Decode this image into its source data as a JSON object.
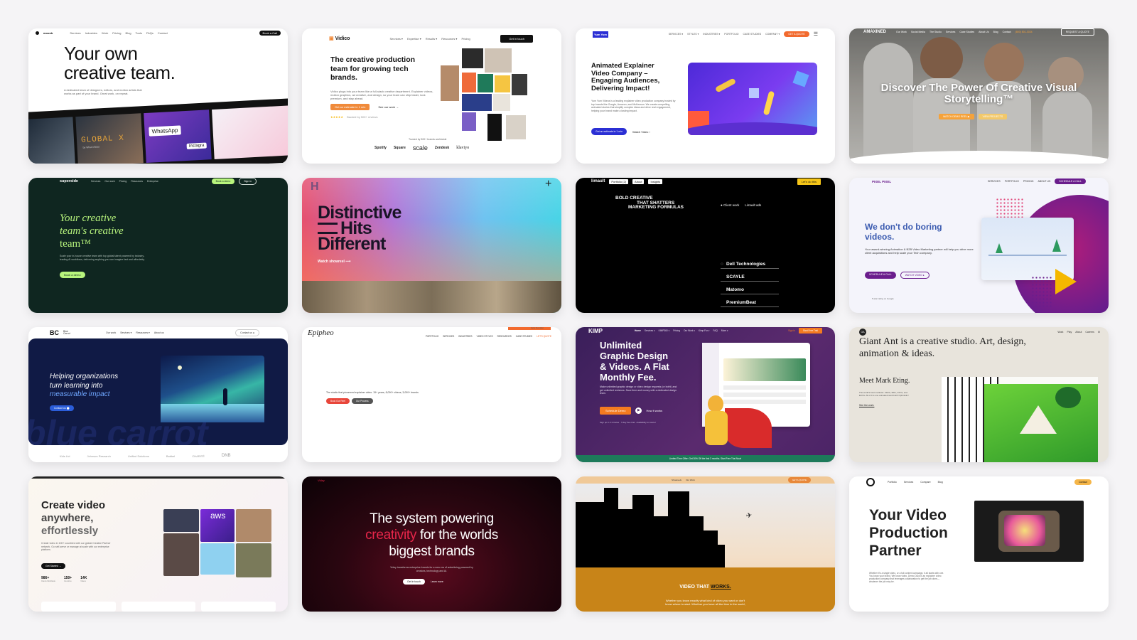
{
  "cards": {
    "c1": {
      "logo": "moonb",
      "nav": [
        "Services",
        "Industries",
        "Work",
        "Pricing",
        "Blog",
        "Tools",
        "FAQs",
        "Contact"
      ],
      "cta": "Book a Call",
      "headline_1": "Your own",
      "headline_2": "creative team.",
      "sub": "A dedicated team of designers, editors, and motion artists that works as part of your brand. Great work, on repeat.",
      "film_1": "GLOBAL X",
      "film_1_sub": "by Wired Asiaa",
      "film_2": "WhatsApp",
      "film_3": "Instagra"
    },
    "c2": {
      "logo": "Vidico",
      "nav": [
        "Services ▾",
        "Expertise ▾",
        "Results ▾",
        "Resources ▾",
        "Pricing"
      ],
      "cta": "Get in touch",
      "headline": "The creative production team for growing tech brands.",
      "sub": "Vidico plugs into your team like a full-stack creative department. Explainer videos, motion graphics, ad creative, and design, so your team can ship faster, look premium, and stay ahead.",
      "btn_primary": "Get an estimate in 1 min",
      "btn_secondary": "See our work →",
      "rating": "★★★★★",
      "rating_text": "Backed by 500+ reviews",
      "trusted": "Trusted by 500+ brands worldwide",
      "logos": [
        "Spotify",
        "Square",
        "scale",
        "Zendesk",
        "klaviyo"
      ]
    },
    "c3": {
      "logo": "Yum Yum",
      "nav": [
        "SERVICES ▾",
        "STYLES ▾",
        "INDUSTRIES ▾",
        "PORTFOLIO",
        "CASE STUDIES",
        "COMPANY ▾"
      ],
      "cta": "GET A QUOTE",
      "headline": "Animated Explainer Video Company – Engaging Audiences, Delivering Impact!",
      "sub": "Yum Yum Videos is a leading explainer video production company trusted by top brands like Google, Amazon, and McKesson. We create compelling, animated stories that simplify complex ideas and drive real engagement, helping your brand make a lasting impact.",
      "btn_primary": "Get an estimate in 1 min",
      "btn_secondary": "Watch Video ›"
    },
    "c4": {
      "logo": "AMAXINED",
      "nav": [
        "Our Work",
        "Social Media",
        "The Studio",
        "Services",
        "Case Studies",
        "About Us",
        "Blog",
        "Contact"
      ],
      "phone": "(800) 801-3024",
      "cta": "REQUEST A QUOTE",
      "headline_1": "Discover The Power Of Creative Visual",
      "headline_2": "Storytelling™",
      "btn_primary": "WATCH DEMO REEL ▶",
      "btn_secondary": "VIEW PROJECTS"
    },
    "c5": {
      "logo": "superside",
      "nav": [
        "Services",
        "Our work",
        "Pricing",
        "Resources",
        "Enterprise"
      ],
      "cta": "Book a demo",
      "signin": "Sign in",
      "headline_1": "Your creative",
      "headline_2": "team's creative",
      "headline_3": "team™",
      "sub": "Scale your in-house creative team with top global talent powered by industry-leading AI workflows, delivering anything you can imagine fast and affordably.",
      "btn": "Book a demo"
    },
    "c6": {
      "logo": "H",
      "plus": "+",
      "headline_1": "Distinctive",
      "headline_2": "Hits",
      "headline_3": "Different",
      "link": "Watch showreel ⟶"
    },
    "c7": {
      "logo": "limault",
      "tabs": [
        "Portfolio (2)",
        "About",
        "Insights"
      ],
      "cta": "Let's do this",
      "headline_1": "BOLD CREATIVE",
      "headline_2": "THAT SHATTERS",
      "headline_3": "MARKETING FORMULAS",
      "filter_1": "Client work",
      "filter_2": "Limault ads",
      "clients": [
        "Dell Technologies",
        "SCAYLE",
        "Matomo",
        "PremiumBeat"
      ]
    },
    "c8": {
      "logo": "PIXEL PIXEL",
      "nav": [
        "SERVICES",
        "PORTFOLIO",
        "PRICING",
        "ABOUT US"
      ],
      "cta": "SCHEDULE A CALL",
      "headline": "We don't do boring videos.",
      "sub": "Your award-winning Animation & B2B Video Marketing partner will help you drive more client acquisitions and help scale your Tech company.",
      "btn_primary": "SCHEDULE A CALL",
      "btn_secondary": "WATCH VIDEO ▸",
      "rating": "5-star rating on Google"
    },
    "c9": {
      "logo": "BC",
      "logo_text": "Blue Carrot",
      "nav": [
        "Our work",
        "Services ▾",
        "Resources ▾",
        "About us"
      ],
      "cta": "Contact us",
      "headline_1": "Helping organizations",
      "headline_2": "turn learning into",
      "headline_3": "measurable impact",
      "btn": "Contact us",
      "bg_text": "blue carrot",
      "logos": [
        "Kids Ltd",
        "Johnson Research",
        "Unified Solutions",
        "Babbel",
        "CHARITÉ",
        "DNB"
      ]
    },
    "c10": {
      "logo": "Epipheo",
      "nav": [
        "PORTFOLIO",
        "SERVICES",
        "INDUSTRIES",
        "VIDEO STYLES",
        "RESOURCES",
        "CASE STUDIES",
        "LET'S QUOTE"
      ],
      "promo": "Get a free video",
      "sub": "The studio that pioneered explainer video. 15+ years, 8,000+ videos, 3,000+ brands",
      "btn_primary": "Book Our Reel",
      "btn_secondary": "Our Process"
    },
    "c11": {
      "logo": "KIMP",
      "nav": [
        "Home",
        "Services ▾",
        "KIMP360 ▾",
        "Pricing",
        "Our Work ▾",
        "Kimp For ▾",
        "FAQ",
        "More ▾"
      ],
      "signin": "Sign in",
      "cta": "Start Free Trial",
      "headline_1": "Unlimited",
      "headline_2": "Graphic Design",
      "headline_3": "& Videos. A Flat",
      "headline_4": "Monthly Fee.",
      "sub": "Make unlimited graphic design or video design requests (or both!) and get unlimited revisions. Save time and money with a dedicated design team.",
      "btn_primary": "Schedule Demo",
      "btn_secondary": "How it works",
      "note": "Sign up in 2 minutes · 7-day free trial · Availability to cancel",
      "banner": "Limited Time Offer: Get 30% Off the first 3 months. Start Free Trial Now!"
    },
    "c12": {
      "logo": "GA",
      "nav": [
        "Work",
        "Play",
        "About",
        "Careers"
      ],
      "headline": "Giant Ant is a creative studio. Art, design, animation & ideas.",
      "subhead": "Meet Mark Eting.",
      "sub": "The world's best marketer. CEOs, MDs, CFOs, and ECOs. All of it is one animated world with Optimistic!",
      "link": "See the work."
    },
    "c13": {
      "headline_1": "Create video",
      "headline_2": "anywhere,",
      "headline_3": "effortlessly",
      "sub": "Create video in 100+ countries with our global Creative Partner network. Go self-serve or manage at scale with our enterprise platform.",
      "btn": "Get Started →",
      "stats": [
        {
          "value": "986+",
          "label": "Clients Worldwide"
        },
        {
          "value": "150+",
          "label": "Countries"
        },
        {
          "value": "14K",
          "label": "Videos"
        }
      ],
      "tile": "aws"
    },
    "c14": {
      "logo": "Vidsy",
      "headline_1": "The system powering",
      "headline_accent": "creativity",
      "headline_2": "for the worlds",
      "headline_3": "biggest brands",
      "sub": "Vidsy transforms enterprise brands for a new era of advertising powered by creators, technology and AI.",
      "btn_primary": "Get in touch",
      "btn_secondary": "Learn more"
    },
    "c15": {
      "nav": [
        "Showreels",
        "Our Work"
      ],
      "cta": "GET A QUOTE",
      "headline_1": "VIDEO THAT",
      "headline_2": "WORKS.",
      "sub_1": "Whether you know exactly what kind of video you want or don't",
      "sub_2": "know where to start. Whether you have all the time in the world,"
    },
    "c16": {
      "nav": [
        "Portfolio",
        "Services",
        "Compare",
        "Blog"
      ],
      "cta": "Contact",
      "headline_1": "Your Video",
      "headline_2": "Production",
      "headline_3": "Partner",
      "sub": "Whether it's a single video, or a full content campaign, it all starts with one. You know your brand. We know video. Demo Duck is an explainer video production company that leverages collaboration to get the job done—whatever the job may be."
    }
  },
  "colors": {
    "page_bg": "#f5f4f6",
    "superside_bg": "#0f2620",
    "superside_accent": "#b8f57d",
    "vidico_orange": "#f08a3a",
    "yumyum_blue": "#2b2fd4",
    "limault_yellow": "#f5c518",
    "pixel_purple": "#6a1d8c",
    "bluecarrot_navy": "#101a45",
    "kimp_purple": "#4b2466",
    "kimp_orange": "#f47b20",
    "vidsy_red": "#e8264a",
    "city_orange": "#c88418"
  }
}
